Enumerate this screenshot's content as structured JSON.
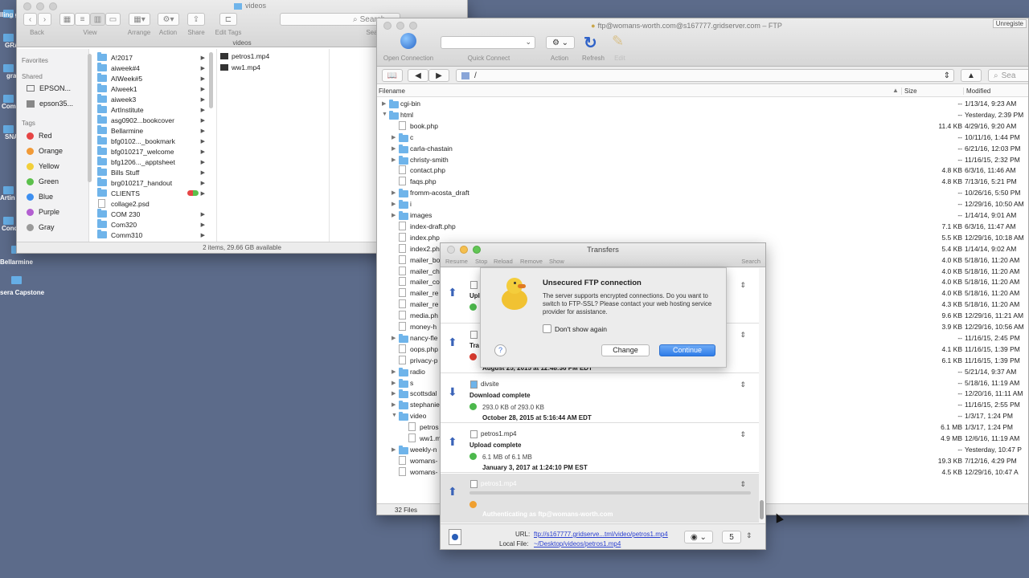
{
  "desktop": {
    "items": [
      "lling g",
      "GRA",
      "gra",
      "Com",
      "SNA",
      "Artin",
      "Cond",
      "Bellarmine",
      "sera Capstone"
    ]
  },
  "finder": {
    "title": "videos",
    "toolbar": {
      "back": "Back",
      "view": "View",
      "arrange": "Arrange",
      "action": "Action",
      "share": "Share",
      "edit_tags": "Edit Tags",
      "search_placeholder": "Search"
    },
    "path_title": "videos",
    "sidebar": {
      "favorites": "Favorites",
      "shared": "Shared",
      "shared_items": [
        "EPSON...",
        "epson35..."
      ],
      "tags_header": "Tags",
      "tags": [
        {
          "name": "Red",
          "color": "#e64545"
        },
        {
          "name": "Orange",
          "color": "#f19a37"
        },
        {
          "name": "Yellow",
          "color": "#f2cf3a"
        },
        {
          "name": "Green",
          "color": "#5cc04c"
        },
        {
          "name": "Blue",
          "color": "#3d8ff0"
        },
        {
          "name": "Purple",
          "color": "#b35fd1"
        },
        {
          "name": "Gray",
          "color": "#9a9a9a"
        }
      ]
    },
    "column1": [
      "A!2017",
      "aiweek#4",
      "AIWeek#5",
      "AIweek1",
      "aiweek3",
      "ArtInstitute",
      "asg0902...bookcover",
      "Bellarmine",
      "bfg0102..._bookmark",
      "bfg010217_welcome",
      "bfg1206..._apptsheet",
      "Bills Stuff",
      "brg010217_handout",
      "CLIENTS",
      "collage2.psd",
      "COM 230",
      "Com320",
      "Comm310"
    ],
    "column2": [
      "petros1.mp4",
      "ww1.mp4"
    ],
    "status": "2 items, 29.66 GB available"
  },
  "ftp": {
    "title": "ftp@womans-worth.com@s167777.gridserver.com – FTP",
    "unregistered": "Unregiste",
    "toolbar": {
      "open_connection": "Open Connection",
      "quick_connect": "Quick Connect",
      "action": "Action",
      "refresh": "Refresh",
      "edit": "Edit"
    },
    "path": "/",
    "search_placeholder": "Sea",
    "columns": {
      "filename": "Filename",
      "size": "Size",
      "modified": "Modified"
    },
    "rows": [
      {
        "name": "cgi-bin",
        "size": "--",
        "mod": "1/13/14, 9:23 AM",
        "lvl": 0,
        "type": "folder",
        "tri": "▶"
      },
      {
        "name": "html",
        "size": "--",
        "mod": "Yesterday, 2:39 PM",
        "lvl": 0,
        "type": "folder",
        "tri": "▼"
      },
      {
        "name": "book.php",
        "size": "11.4 KB",
        "mod": "4/29/16, 9:20 AM",
        "lvl": 1,
        "type": "file",
        "tri": ""
      },
      {
        "name": "c",
        "size": "--",
        "mod": "10/11/16, 1:44 PM",
        "lvl": 1,
        "type": "folder",
        "tri": "▶"
      },
      {
        "name": "carla-chastain",
        "size": "--",
        "mod": "6/21/16, 12:03 PM",
        "lvl": 1,
        "type": "folder",
        "tri": "▶"
      },
      {
        "name": "christy-smith",
        "size": "--",
        "mod": "11/16/15, 2:32 PM",
        "lvl": 1,
        "type": "folder",
        "tri": "▶"
      },
      {
        "name": "contact.php",
        "size": "4.8 KB",
        "mod": "6/3/16, 11:46 AM",
        "lvl": 1,
        "type": "file",
        "tri": ""
      },
      {
        "name": "faqs.php",
        "size": "4.8 KB",
        "mod": "7/13/16, 5:21 PM",
        "lvl": 1,
        "type": "file",
        "tri": ""
      },
      {
        "name": "fromm-acosta_draft",
        "size": "--",
        "mod": "10/26/16, 5:50 PM",
        "lvl": 1,
        "type": "folder",
        "tri": "▶"
      },
      {
        "name": "i",
        "size": "--",
        "mod": "12/29/16, 10:50 AM",
        "lvl": 1,
        "type": "folder",
        "tri": "▶"
      },
      {
        "name": "images",
        "size": "--",
        "mod": "1/14/14, 9:01 AM",
        "lvl": 1,
        "type": "folder",
        "tri": "▶"
      },
      {
        "name": "index-draft.php",
        "size": "7.1 KB",
        "mod": "6/3/16, 11:47 AM",
        "lvl": 1,
        "type": "file",
        "tri": ""
      },
      {
        "name": "index.php",
        "size": "5.5 KB",
        "mod": "12/29/16, 10:18 AM",
        "lvl": 1,
        "type": "file",
        "tri": ""
      },
      {
        "name": "index2.ph",
        "size": "5.4 KB",
        "mod": "1/14/14, 9:02 AM",
        "lvl": 1,
        "type": "file",
        "tri": ""
      },
      {
        "name": "mailer_bo",
        "size": "4.0 KB",
        "mod": "5/18/16, 11:20 AM",
        "lvl": 1,
        "type": "file",
        "tri": ""
      },
      {
        "name": "mailer_ch",
        "size": "4.0 KB",
        "mod": "5/18/16, 11:20 AM",
        "lvl": 1,
        "type": "file",
        "tri": ""
      },
      {
        "name": "mailer_co",
        "size": "4.0 KB",
        "mod": "5/18/16, 11:20 AM",
        "lvl": 1,
        "type": "file",
        "tri": ""
      },
      {
        "name": "mailer_re",
        "size": "4.0 KB",
        "mod": "5/18/16, 11:20 AM",
        "lvl": 1,
        "type": "file",
        "tri": ""
      },
      {
        "name": "mailer_re",
        "size": "4.3 KB",
        "mod": "5/18/16, 11:20 AM",
        "lvl": 1,
        "type": "file",
        "tri": ""
      },
      {
        "name": "media.ph",
        "size": "9.6 KB",
        "mod": "12/29/16, 11:21 AM",
        "lvl": 1,
        "type": "file",
        "tri": ""
      },
      {
        "name": "money-h",
        "size": "3.9 KB",
        "mod": "12/29/16, 10:56 AM",
        "lvl": 1,
        "type": "file",
        "tri": ""
      },
      {
        "name": "nancy-fle",
        "size": "--",
        "mod": "11/16/15, 2:45 PM",
        "lvl": 1,
        "type": "folder",
        "tri": "▶"
      },
      {
        "name": "oops.php",
        "size": "4.1 KB",
        "mod": "11/16/15, 1:39 PM",
        "lvl": 1,
        "type": "file",
        "tri": ""
      },
      {
        "name": "privacy-p",
        "size": "6.1 KB",
        "mod": "11/16/15, 1:39 PM",
        "lvl": 1,
        "type": "file",
        "tri": ""
      },
      {
        "name": "radio",
        "size": "--",
        "mod": "5/21/14, 9:37 AM",
        "lvl": 1,
        "type": "folder",
        "tri": "▶"
      },
      {
        "name": "s",
        "size": "--",
        "mod": "5/18/16, 11:19 AM",
        "lvl": 1,
        "type": "folder",
        "tri": "▶"
      },
      {
        "name": "scottsdal",
        "size": "--",
        "mod": "12/20/16, 11:11 AM",
        "lvl": 1,
        "type": "folder",
        "tri": "▶"
      },
      {
        "name": "stephanie",
        "size": "--",
        "mod": "11/16/15, 2:55 PM",
        "lvl": 1,
        "type": "folder",
        "tri": "▶"
      },
      {
        "name": "video",
        "size": "--",
        "mod": "1/3/17, 1:24 PM",
        "lvl": 1,
        "type": "folder",
        "tri": "▼"
      },
      {
        "name": "petros",
        "size": "6.1 MB",
        "mod": "1/3/17, 1:24 PM",
        "lvl": 2,
        "type": "file",
        "tri": ""
      },
      {
        "name": "ww1.m",
        "size": "4.9 MB",
        "mod": "12/6/16, 11:19 AM",
        "lvl": 2,
        "type": "file",
        "tri": ""
      },
      {
        "name": "weekly-n",
        "size": "--",
        "mod": "Yesterday, 10:47 P",
        "lvl": 1,
        "type": "folder",
        "tri": "▶"
      },
      {
        "name": "womans-",
        "size": "19.3 KB",
        "mod": "7/12/16, 4:29 PM",
        "lvl": 1,
        "type": "file",
        "tri": ""
      },
      {
        "name": "womans-",
        "size": "4.5 KB",
        "mod": "12/29/16, 10:47 A",
        "lvl": 1,
        "type": "file",
        "tri": ""
      }
    ],
    "status": "32 Files"
  },
  "transfers": {
    "title": "Transfers",
    "toolbar": {
      "resume": "Resume",
      "stop": "Stop",
      "reload": "Reload",
      "remove": "Remove",
      "show": "Show",
      "search": "Search"
    },
    "items": [
      {
        "file": "",
        "status": "Upl",
        "size": "",
        "date": "",
        "dot": "#4cb84c",
        "dir": "up"
      },
      {
        "file": "",
        "status": "Tra",
        "size": "",
        "date": "August 25, 2015 at 12:48:36 PM EDT",
        "dot": "#d83a2e",
        "dir": "up"
      },
      {
        "file": "divsite",
        "status": "Download complete",
        "size": "293.0 KB of 293.0 KB",
        "date": "October 28, 2015 at 5:16:44 AM EDT",
        "dot": "#4cb84c",
        "dir": "down"
      },
      {
        "file": "petros1.mp4",
        "status": "Upload complete",
        "size": "6.1 MB of 6.1 MB",
        "date": "January 3, 2017 at 1:24:10 PM EST",
        "dot": "#4cb84c",
        "dir": "up"
      },
      {
        "file": "petros1.mp4",
        "status": "",
        "size": "",
        "date": "Authenticating as ftp@womans-worth.com",
        "dot": "#f0a030",
        "dir": "up"
      }
    ],
    "url_label": "URL:",
    "url": "ftp://s167777.gridserve...tml/video/petros1.mp4",
    "local_label": "Local File:",
    "local": "~/Desktop/videos/petros1.mp4",
    "connections": "5"
  },
  "dialog": {
    "title": "Unsecured FTP connection",
    "message": "The server supports encrypted connections. Do you want to switch to FTP-SSL? Please contact your web hosting service provider for assistance.",
    "checkbox": "Don't show again",
    "change": "Change",
    "continue": "Continue",
    "help": "?"
  },
  "colors": {
    "desktop": "#5c6b8a",
    "accent": "#3d8ff0",
    "folder": "#6fb4ea"
  }
}
